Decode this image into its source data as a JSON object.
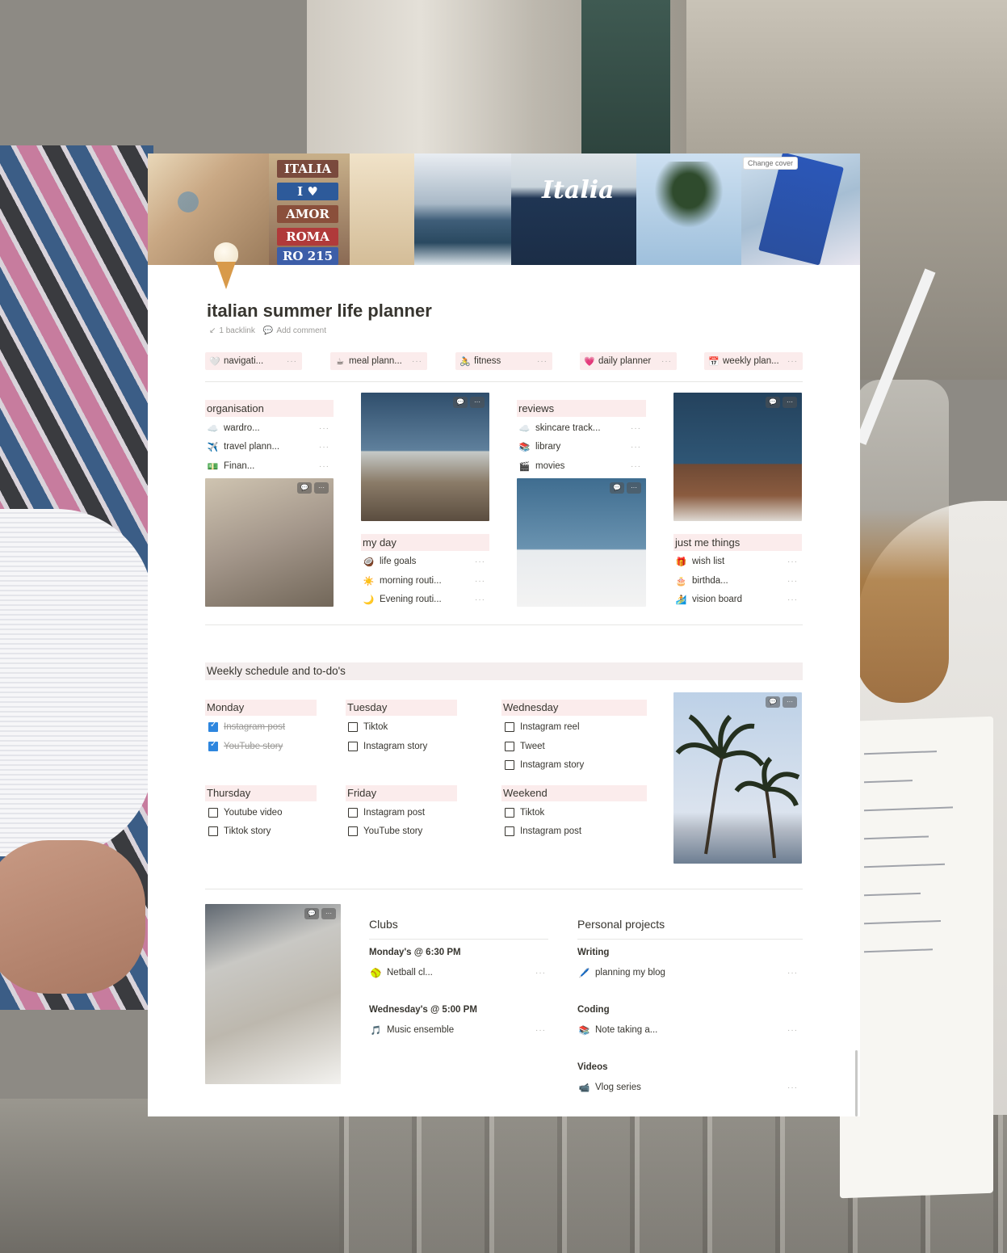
{
  "cover": {
    "change_cover_label": "Change cover",
    "signs": [
      "ITALIA",
      "I ♥",
      "AMOR",
      "ROMA",
      "RO 215"
    ],
    "sweater_text": "Italia"
  },
  "page": {
    "icon": "soft-serve-icon",
    "title": "italian summer life planner",
    "backlinks": "1 backlink",
    "add_comment": "Add comment"
  },
  "tabs": [
    {
      "icon": "white-heart-icon",
      "emoji": "🤍",
      "label": "navigati...",
      "more": "···"
    },
    {
      "icon": "coffee-icon",
      "emoji": "☕",
      "label": "meal plann...",
      "more": "···"
    },
    {
      "icon": "bicycle-icon",
      "emoji": "🚴",
      "label": "fitness",
      "more": "···"
    },
    {
      "icon": "pink-heart-icon",
      "emoji": "💗",
      "label": "daily planner",
      "more": "···"
    },
    {
      "icon": "calendar-icon",
      "emoji": "📅",
      "label": "weekly plan...",
      "more": "···"
    }
  ],
  "organisation": {
    "title": "organisation",
    "items": [
      {
        "emoji": "☁️",
        "label": "wardro...",
        "more": "···"
      },
      {
        "emoji": "✈️",
        "label": "travel plann...",
        "more": "···"
      },
      {
        "emoji": "💵",
        "label": "Finan...",
        "more": "···"
      }
    ]
  },
  "my_day": {
    "title": "my day",
    "items": [
      {
        "emoji": "🥥",
        "label": "life goals",
        "more": "···"
      },
      {
        "emoji": "☀️",
        "label": "morning routi...",
        "more": "···"
      },
      {
        "emoji": "🌙",
        "label": "Evening routi...",
        "more": "···"
      }
    ]
  },
  "reviews": {
    "title": "reviews",
    "items": [
      {
        "emoji": "☁️",
        "label": "skincare track...",
        "more": "···"
      },
      {
        "emoji": "📚",
        "label": "library",
        "more": "···"
      },
      {
        "emoji": "🎬",
        "label": "movies",
        "more": "···"
      }
    ]
  },
  "just_me": {
    "title": "just me things",
    "items": [
      {
        "emoji": "🎁",
        "label": "wish list",
        "more": "···"
      },
      {
        "emoji": "🎂",
        "label": "birthda...",
        "more": "···"
      },
      {
        "emoji": "🏄",
        "label": "vision board",
        "more": "···"
      }
    ]
  },
  "photo_tools": {
    "comment": "💬",
    "more": "···"
  },
  "weekly": {
    "title": "Weekly schedule and to-do's",
    "days": [
      {
        "name": "Monday",
        "todos": [
          {
            "text": "Instagram post",
            "checked": true
          },
          {
            "text": "YouTube story",
            "checked": true
          }
        ]
      },
      {
        "name": "Tuesday",
        "todos": [
          {
            "text": "Tiktok",
            "checked": false
          },
          {
            "text": "Instagram story",
            "checked": false
          }
        ]
      },
      {
        "name": "Wednesday",
        "todos": [
          {
            "text": "Instagram reel",
            "checked": false
          },
          {
            "text": "Tweet",
            "checked": false
          },
          {
            "text": "Instagram story",
            "checked": false
          }
        ]
      },
      {
        "name": "Thursday",
        "todos": [
          {
            "text": "Youtube video",
            "checked": false
          },
          {
            "text": "Tiktok story",
            "checked": false
          }
        ]
      },
      {
        "name": "Friday",
        "todos": [
          {
            "text": "Instagram post",
            "checked": false
          },
          {
            "text": "YouTube story",
            "checked": false
          }
        ]
      },
      {
        "name": "Weekend",
        "todos": [
          {
            "text": "Tiktok",
            "checked": false
          },
          {
            "text": "Instagram post",
            "checked": false
          }
        ]
      }
    ]
  },
  "clubs": {
    "title": "Clubs",
    "groups": [
      {
        "heading": "Monday's @ 6:30 PM",
        "emoji": "🥎",
        "label": "Netball cl...",
        "more": "···"
      },
      {
        "heading": "Wednesday's @ 5:00 PM",
        "emoji": "🎵",
        "label": "Music ensemble",
        "more": "···"
      }
    ]
  },
  "projects": {
    "title": "Personal projects",
    "groups": [
      {
        "heading": "Writing",
        "emoji": "🖊️",
        "label": "planning my blog",
        "more": "···"
      },
      {
        "heading": "Coding",
        "emoji": "📚",
        "label": "Note taking a...",
        "more": "···"
      },
      {
        "heading": "Videos",
        "emoji": "📹",
        "label": "Vlog series",
        "more": "···"
      }
    ]
  },
  "colors": {
    "tab_bg": "#fbecec",
    "section_bg": "#f4eeee",
    "check_blue": "#2e86de",
    "text": "#37352f",
    "muted": "#9b9a97"
  }
}
